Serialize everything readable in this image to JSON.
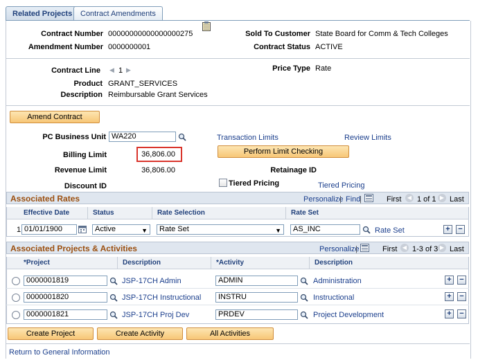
{
  "tabs": [
    {
      "label": "Related Projects",
      "active": true
    },
    {
      "label": "Contract Amendments",
      "active": false
    }
  ],
  "header": {
    "contract_number_label": "Contract Number",
    "contract_number": "00000000000000000275",
    "amendment_number_label": "Amendment Number",
    "amendment_number": "0000000001",
    "sold_to_label": "Sold To Customer",
    "sold_to": "State Board for Comm & Tech Colleges",
    "contract_status_label": "Contract Status",
    "contract_status": "ACTIVE"
  },
  "line": {
    "contract_line_label": "Contract Line",
    "contract_line": "1",
    "price_type_label": "Price Type",
    "price_type": "Rate",
    "product_label": "Product",
    "product": "GRANT_SERVICES",
    "description_label": "Description",
    "description": "Reimbursable Grant Services"
  },
  "amend_button": "Amend Contract",
  "limits": {
    "pc_bu_label": "PC Business Unit",
    "pc_bu": "WA220",
    "transaction_limits": "Transaction Limits",
    "review_limits": "Review Limits",
    "billing_limit_label": "Billing Limit",
    "billing_limit": "36,806.00",
    "perform_limit_checking": "Perform Limit Checking",
    "revenue_limit_label": "Revenue Limit",
    "revenue_limit": "36,806.00",
    "retainage_label": "Retainage ID",
    "discount_label": "Discount ID",
    "tiered_pricing_check": "Tiered Pricing",
    "tiered_pricing_link": "Tiered Pricing"
  },
  "rates": {
    "title": "Associated Rates",
    "personalize": "Personalize",
    "find": "Find",
    "first": "First",
    "range": "1 of 1",
    "last": "Last",
    "columns": [
      "Effective Date",
      "Status",
      "Rate Selection",
      "Rate Set"
    ],
    "rows": [
      {
        "num": "1",
        "date": "01/01/1900",
        "status": "Active",
        "selection": "Rate Set",
        "rate_set": "AS_INC",
        "link": "Rate Set"
      }
    ]
  },
  "projects": {
    "title": "Associated Projects & Activities",
    "personalize": "Personalize",
    "first": "First",
    "range": "1-3 of 3",
    "last": "Last",
    "columns": [
      "*Project",
      "Description",
      "*Activity",
      "Description"
    ],
    "rows": [
      {
        "project": "0000001819",
        "proj_desc": "JSP-17CH Admin",
        "activity": "ADMIN",
        "act_desc": "Administration"
      },
      {
        "project": "0000001820",
        "proj_desc": "JSP-17CH Instructional",
        "activity": "INSTRU",
        "act_desc": "Instructional"
      },
      {
        "project": "0000001821",
        "proj_desc": "JSP-17CH Proj Dev",
        "activity": "PRDEV",
        "act_desc": "Project Development"
      }
    ]
  },
  "buttons": {
    "create_project": "Create Project",
    "create_activity": "Create Activity",
    "all_activities": "All Activities"
  },
  "return_link": "Return to General Information",
  "colors": {
    "accent_link": "#1a3e8c",
    "button_fill": "#f7c676",
    "highlight": "#d9342b"
  }
}
